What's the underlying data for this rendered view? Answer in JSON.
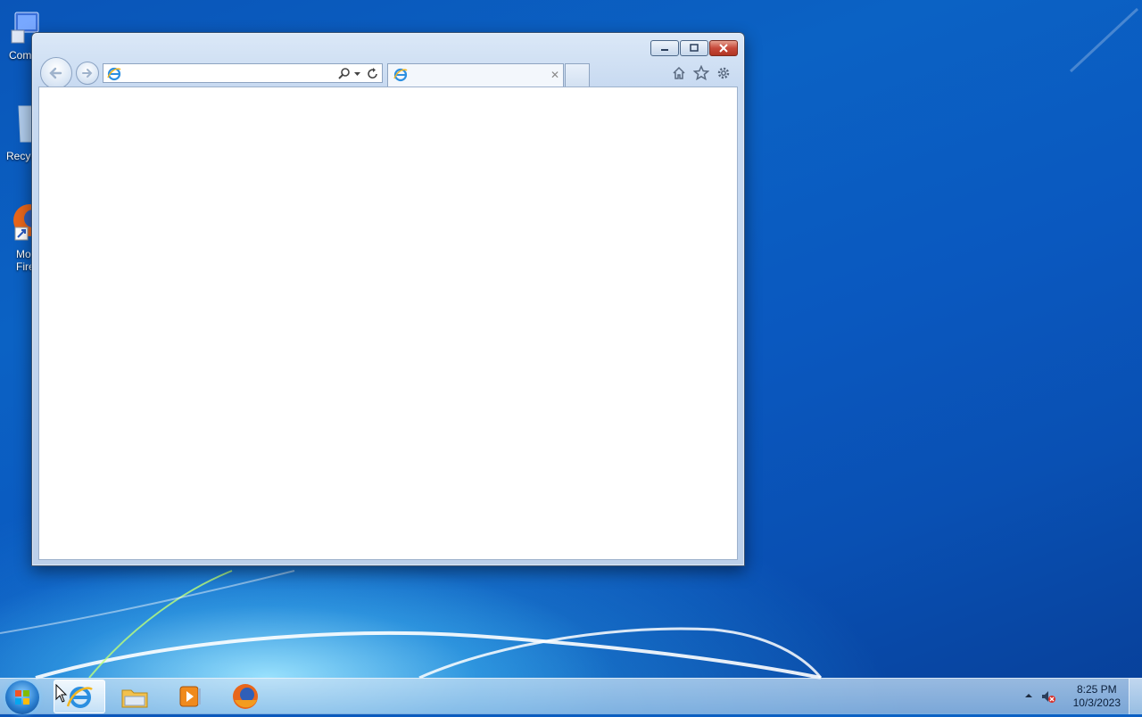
{
  "desktop": {
    "icons": [
      {
        "label": "Com",
        "icon": "computer-icon"
      },
      {
        "label": "Recyc",
        "icon": "recycle-bin-icon"
      },
      {
        "label": "Mo\nFire",
        "line1": "Mo",
        "line2": "Fire",
        "icon": "firefox-icon"
      }
    ]
  },
  "browser": {
    "address_value": "",
    "tab_title": "",
    "icons": [
      "back-icon",
      "forward-icon",
      "search-icon",
      "dropdown-icon",
      "refresh-icon",
      "tab-close-icon",
      "home-icon",
      "favorites-icon",
      "tools-gear-icon",
      "minimize-icon",
      "maximize-icon",
      "close-icon"
    ],
    "tab_close_glyph": "✕"
  },
  "taskbar": {
    "apps": [
      "Internet Explorer",
      "Windows Explorer",
      "Windows Media Player",
      "Firefox"
    ],
    "clock_time": "8:25 PM",
    "clock_date": "10/3/2023"
  },
  "colors": {
    "close_button": "#c7493a",
    "desktop_blue": "#0a58bf"
  }
}
